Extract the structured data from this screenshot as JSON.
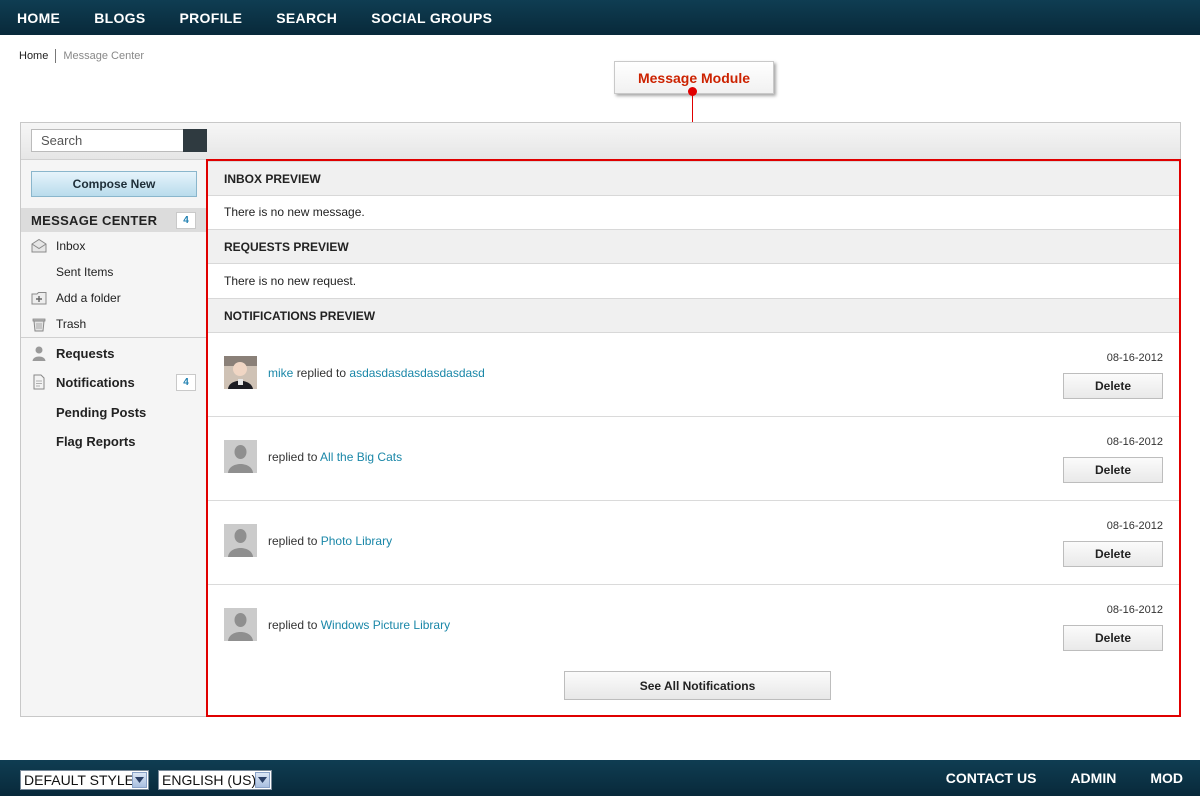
{
  "topnav": {
    "items": [
      "HOME",
      "BLOGS",
      "PROFILE",
      "SEARCH",
      "SOCIAL GROUPS"
    ]
  },
  "breadcrumb": {
    "home": "Home",
    "current": "Message Center"
  },
  "callout": {
    "label": "Message Module"
  },
  "search": {
    "placeholder": "Search"
  },
  "sidebar": {
    "compose_label": "Compose New",
    "message_center": {
      "title": "MESSAGE CENTER",
      "count": "4"
    },
    "items": [
      {
        "label": "Inbox",
        "icon": "envelope-icon"
      },
      {
        "label": "Sent Items",
        "icon": ""
      },
      {
        "label": "Add a folder",
        "icon": "add-folder-icon"
      },
      {
        "label": "Trash",
        "icon": "trash-icon"
      },
      {
        "label": "Requests",
        "icon": "user-icon"
      },
      {
        "label": "Notifications",
        "icon": "document-icon",
        "count": "4"
      },
      {
        "label": "Pending Posts",
        "icon": ""
      },
      {
        "label": "Flag Reports",
        "icon": ""
      }
    ]
  },
  "module": {
    "inbox_title": "INBOX PREVIEW",
    "inbox_empty": "There is no new message.",
    "requests_title": "REQUESTS PREVIEW",
    "requests_empty": "There is no new request.",
    "notifications_title": "NOTIFICATIONS PREVIEW",
    "notifications": [
      {
        "user": "mike",
        "action": "replied to",
        "target": "asdasdasdasdasdasdasd",
        "date": "08-16-2012",
        "delete_label": "Delete"
      },
      {
        "user": "",
        "action": "replied to",
        "target": "All the Big Cats",
        "date": "08-16-2012",
        "delete_label": "Delete"
      },
      {
        "user": "",
        "action": "replied to",
        "target": "Photo Library",
        "date": "08-16-2012",
        "delete_label": "Delete"
      },
      {
        "user": "",
        "action": "replied to",
        "target": "Windows Picture Library",
        "date": "08-16-2012",
        "delete_label": "Delete"
      }
    ],
    "see_all_label": "See All Notifications"
  },
  "footer": {
    "style_select": "DEFAULT STYLE",
    "language_select": "ENGLISH (US)",
    "links": [
      "CONTACT US",
      "ADMIN",
      "MOD"
    ]
  },
  "colors": {
    "nav_bg": "#0c3549",
    "accent_link": "#1a87a8",
    "highlight_border": "#e00000",
    "callout_text": "#cc2200"
  }
}
